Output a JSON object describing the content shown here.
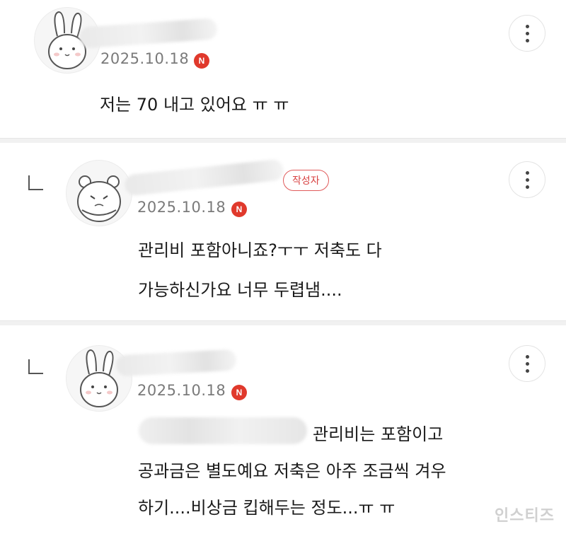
{
  "comments": [
    {
      "date": "2025.10.18",
      "new_badge": "N",
      "avatar": "rabbit-avatar-icon",
      "lines": [
        "저는 70 내고 있어요 ㅠ ㅠ"
      ]
    },
    {
      "date": "2025.10.18",
      "new_badge": "N",
      "author_badge": "작성자",
      "avatar": "hamster-avatar-icon",
      "lines": [
        "관리비 포함아니죠?ㅜㅜ 저축도 다",
        "가능하신가요 너무 두렵냄...."
      ]
    },
    {
      "date": "2025.10.18",
      "new_badge": "N",
      "avatar": "rabbit-avatar-icon",
      "lines": [
        "관리비는 포함이고",
        "공과금은 별도예요 저축은 아주 조금씩 겨우",
        "하기....비상금 킵해두는 정도...ㅠ ㅠ"
      ]
    }
  ],
  "icons": {
    "more": "more-vertical-icon",
    "reply": "reply-arrow-icon"
  },
  "watermark": "인스티즈",
  "colors": {
    "new_badge": "#e0392c",
    "author_badge": "#d84242",
    "date": "#7a7a7a"
  }
}
